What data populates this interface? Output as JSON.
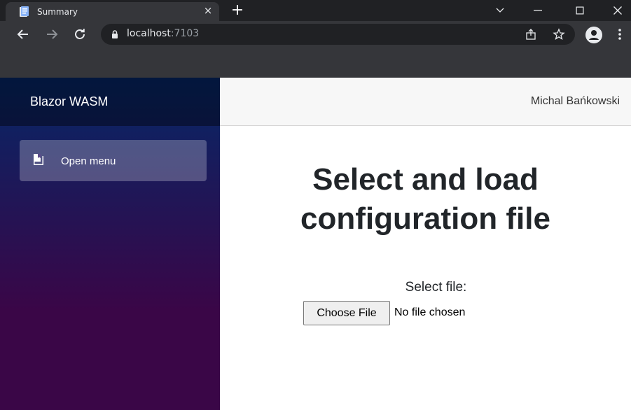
{
  "browser": {
    "tab_title": "Summary",
    "tab_close": "×",
    "new_tab": "+",
    "url_host": "localhost",
    "url_port": ":7103"
  },
  "app": {
    "brand": "Blazor WASM",
    "nav": [
      {
        "label": "Open menu",
        "icon": "book-icon"
      }
    ],
    "user_name": "Michal Bańkowski"
  },
  "main": {
    "heading": "Select and load configuration file",
    "file_label": "Select file:",
    "choose_button": "Choose File",
    "no_file_text": "No file chosen"
  },
  "colors": {
    "chrome_dark": "#202124",
    "chrome_toolbar": "#35363a",
    "sidebar_top": "#052767",
    "sidebar_bottom": "#3a0647",
    "topbar": "#f7f7f7"
  }
}
